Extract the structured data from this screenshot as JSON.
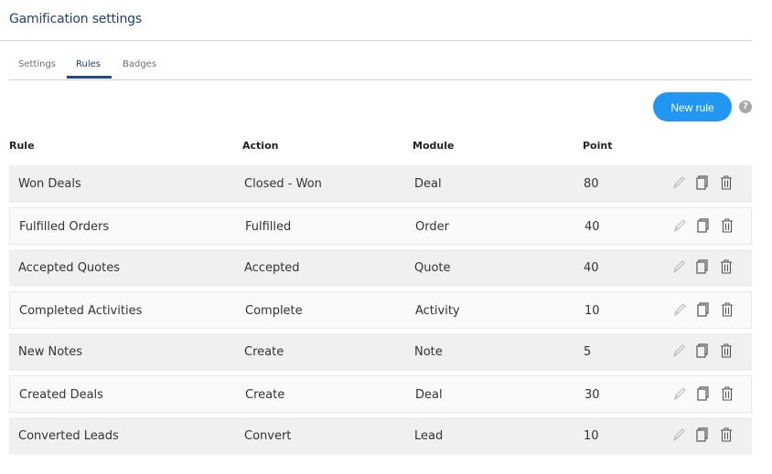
{
  "header": {
    "title": "Gamification settings"
  },
  "tabs": [
    {
      "label": "Settings",
      "active": false
    },
    {
      "label": "Rules",
      "active": true
    },
    {
      "label": "Badges",
      "active": false
    }
  ],
  "toolbar": {
    "new_rule_label": "New rule",
    "help_glyph": "?"
  },
  "table": {
    "columns": [
      "Rule",
      "Action",
      "Module",
      "Point"
    ],
    "rows": [
      {
        "rule": "Won Deals",
        "action": "Closed - Won",
        "module": "Deal",
        "point": "80"
      },
      {
        "rule": "Fulfilled Orders",
        "action": "Fulfilled",
        "module": "Order",
        "point": "40"
      },
      {
        "rule": "Accepted Quotes",
        "action": "Accepted",
        "module": "Quote",
        "point": "40"
      },
      {
        "rule": "Completed Activities",
        "action": "Complete",
        "module": "Activity",
        "point": "10"
      },
      {
        "rule": "New Notes",
        "action": "Create",
        "module": "Note",
        "point": "5"
      },
      {
        "rule": "Created Deals",
        "action": "Create",
        "module": "Deal",
        "point": "30"
      },
      {
        "rule": "Converted Leads",
        "action": "Convert",
        "module": "Lead",
        "point": "10"
      }
    ],
    "row_actions": [
      "edit-icon",
      "copy-icon",
      "delete-icon"
    ]
  },
  "colors": {
    "accent": "#2196f3",
    "title": "#1f3f7a",
    "tab_active": "#1f4a8a"
  }
}
